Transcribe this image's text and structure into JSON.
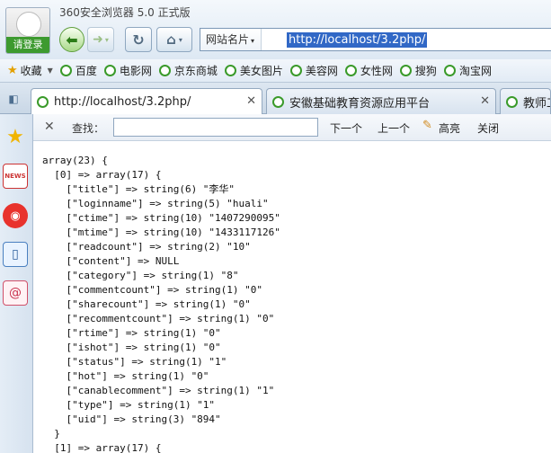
{
  "app": {
    "title": "360安全浏览器 5.0 正式版",
    "login_label": "请登录"
  },
  "address": {
    "prefix_label": "网站名片",
    "url": "http://localhost/3.2php/"
  },
  "bookmarks": [
    {
      "label": "收藏",
      "kind": "star"
    },
    {
      "label": "百度"
    },
    {
      "label": "电影网"
    },
    {
      "label": "京东商城"
    },
    {
      "label": "美女图片"
    },
    {
      "label": "美容网"
    },
    {
      "label": "女性网"
    },
    {
      "label": "搜狗"
    },
    {
      "label": "淘宝网"
    }
  ],
  "tabs": [
    {
      "label": "http://localhost/3.2php/",
      "active": true
    },
    {
      "label": "安徽基础教育资源应用平台",
      "active": false
    },
    {
      "label": "教师工",
      "active": false
    }
  ],
  "findbar": {
    "label": "查找：",
    "value": "",
    "next_label": "下一个",
    "prev_label": "上一个",
    "highlight_label": "高亮",
    "close_label": "关闭"
  },
  "dump_lines": [
    "array(23) {",
    "  [0] => array(17) {",
    "    [\"title\"] => string(6) \"李华\"",
    "    [\"loginname\"] => string(5) \"huali\"",
    "    [\"ctime\"] => string(10) \"1407290095\"",
    "    [\"mtime\"] => string(10) \"1433117126\"",
    "    [\"readcount\"] => string(2) \"10\"",
    "    [\"content\"] => NULL",
    "    [\"category\"] => string(1) \"8\"",
    "    [\"commentcount\"] => string(1) \"0\"",
    "    [\"sharecount\"] => string(1) \"0\"",
    "    [\"recommentcount\"] => string(1) \"0\"",
    "    [\"rtime\"] => string(1) \"0\"",
    "    [\"ishot\"] => string(1) \"0\"",
    "    [\"status\"] => string(1) \"1\"",
    "    [\"hot\"] => string(1) \"0\"",
    "    [\"canablecomment\"] => string(1) \"1\"",
    "    [\"type\"] => string(1) \"1\"",
    "    [\"uid\"] => string(3) \"894\"",
    "  }",
    "  [1] => array(17) {"
  ]
}
